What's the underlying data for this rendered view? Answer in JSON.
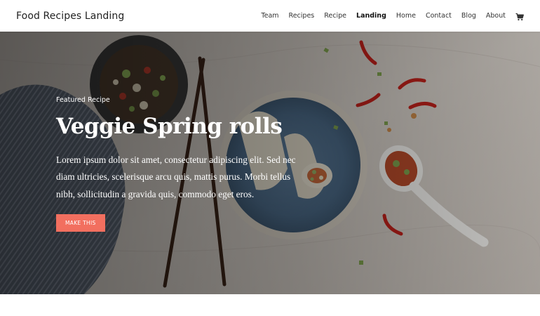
{
  "site": {
    "title": "Food Recipes Landing"
  },
  "nav": {
    "items": [
      {
        "label": "Team",
        "active": false
      },
      {
        "label": "Recipes",
        "active": false
      },
      {
        "label": "Recipe",
        "active": false
      },
      {
        "label": "Landing",
        "active": true
      },
      {
        "label": "Home",
        "active": false
      },
      {
        "label": "Contact",
        "active": false
      },
      {
        "label": "Blog",
        "active": false
      },
      {
        "label": "About",
        "active": false
      }
    ],
    "cart_icon": "cart-icon"
  },
  "hero": {
    "eyebrow": "Featured Recipe",
    "title": "Veggie Spring rolls",
    "body": "Lorem ipsum dolor sit amet, consectetur adipiscing elit. Sed nec diam ultricies, scelerisque arcu quis, mattis purus. Morbi tellus nibh, sollicitudin a gravida quis, commodo eget eros.",
    "cta_label": "MAKE THIS"
  },
  "colors": {
    "accent": "#f26f5f",
    "hero_text": "#ffffff",
    "header_bg": "#ffffff"
  }
}
